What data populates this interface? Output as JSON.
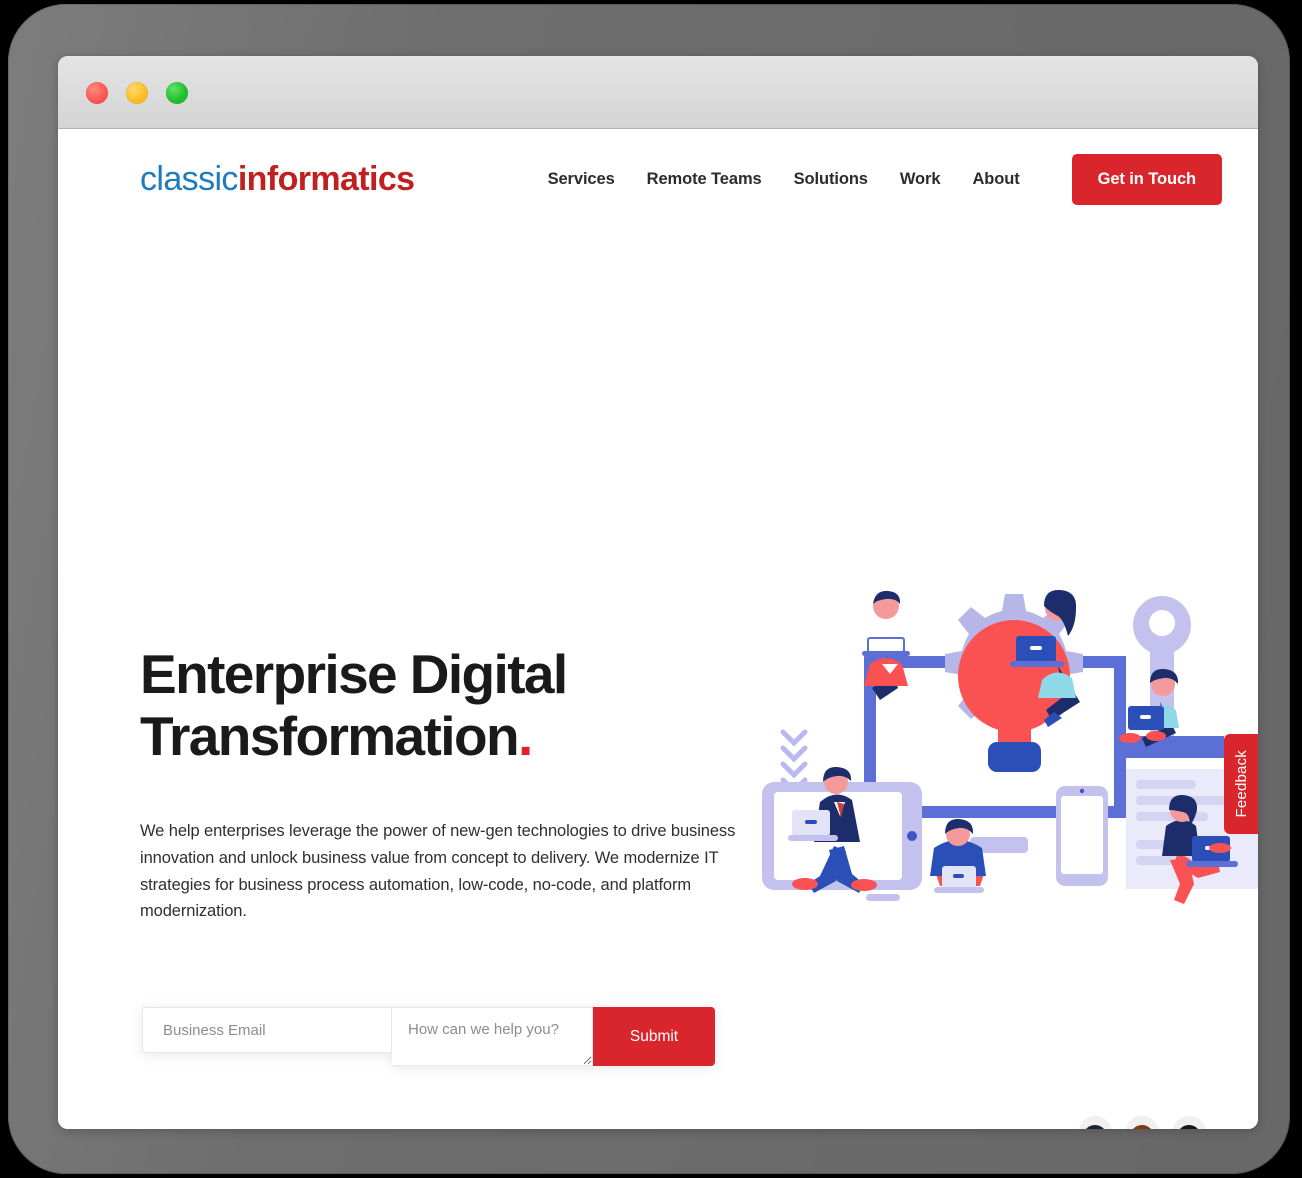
{
  "window": {
    "traffic_lights": [
      {
        "name": "close",
        "color": "#fb5b52"
      },
      {
        "name": "minimize",
        "color": "#fcbe28"
      },
      {
        "name": "maximize",
        "color": "#1fc22e"
      }
    ]
  },
  "header": {
    "logo": {
      "part1": "classic",
      "part2": "informatics",
      "part1_color": "#1f7bbf",
      "part2_color": "#c0201f"
    },
    "nav": [
      {
        "label": "Services"
      },
      {
        "label": "Remote Teams"
      },
      {
        "label": "Solutions"
      },
      {
        "label": "Work"
      },
      {
        "label": "About"
      }
    ],
    "cta": {
      "label": "Get in Touch",
      "background": "#d9262c",
      "color": "#ffffff"
    }
  },
  "hero": {
    "title_line1": "Enterprise Digital",
    "title_line2": "Transformation",
    "title_accent": ".",
    "title_accent_color": "#e01f28",
    "paragraph": "We help enterprises leverage the power of new-gen technologies to drive business innovation and unlock business value from concept to delivery. We modernize IT strategies for business process automation, low-code, no-code, and platform modernization.",
    "form": {
      "email_placeholder": "Business Email",
      "email_value": "",
      "message_placeholder": "How can we help you?",
      "message_value": "",
      "submit_label": "Submit",
      "submit_color": "#d9262c"
    }
  },
  "feedback_tab": {
    "label": "Feedback",
    "background": "#d9262c"
  },
  "illustration": {
    "name": "digital-transformation-illustration",
    "palette": {
      "gear_purple": "#b7b6e8",
      "bulb_red": "#fa5252",
      "bulb_base_blue": "#2b4fb8",
      "device_blue": "#5b6fd6",
      "light_lavender": "#d6d6f5",
      "pale_lavender": "#e8e8fa",
      "navy": "#1d2c6b",
      "cyan_top": "#8ed8e8",
      "skin": "#f59a9a",
      "red_accent": "#fa5252",
      "white": "#ffffff"
    }
  },
  "avatars": [
    {
      "name": "avatar-1",
      "hair": "#1b2430",
      "shoulders": "#3b6aa8"
    },
    {
      "name": "avatar-2",
      "hair": "#7d3b12",
      "shoulders": "#c4622a"
    },
    {
      "name": "avatar-3",
      "hair": "#16161b",
      "shoulders": "#2b2b33"
    }
  ]
}
